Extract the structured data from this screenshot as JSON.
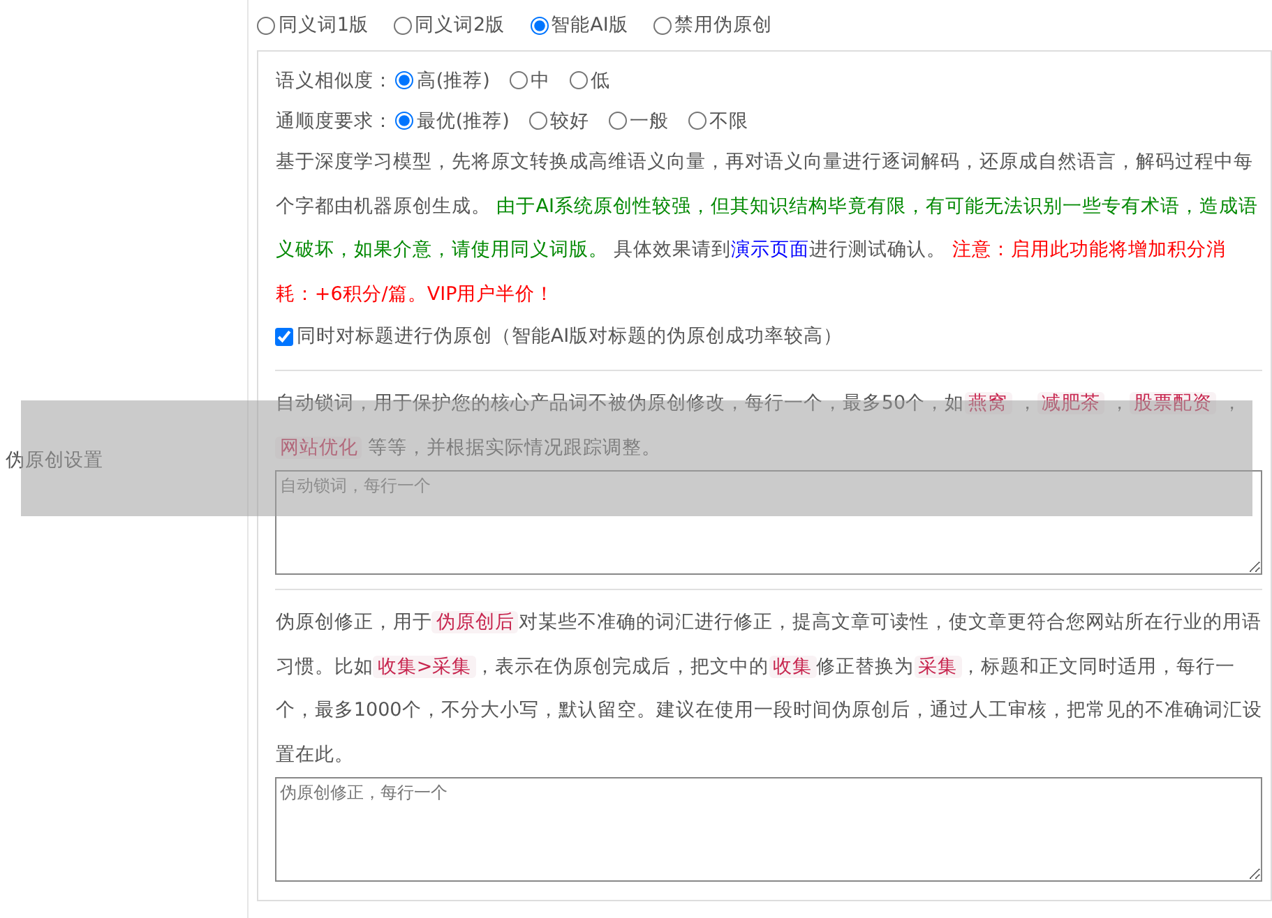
{
  "mode_options": [
    {
      "label": "同义词1版",
      "selected": false
    },
    {
      "label": "同义词2版",
      "selected": false
    },
    {
      "label": "智能AI版",
      "selected": true
    },
    {
      "label": "禁用伪原创",
      "selected": false
    }
  ],
  "settings_label": "伪原创设置",
  "similarity": {
    "label": "语义相似度：",
    "options": [
      {
        "label": "高(推荐)",
        "selected": true
      },
      {
        "label": "中",
        "selected": false
      },
      {
        "label": "低",
        "selected": false
      }
    ]
  },
  "fluency": {
    "label": "通顺度要求：",
    "options": [
      {
        "label": "最优(推荐)",
        "selected": true
      },
      {
        "label": "较好",
        "selected": false
      },
      {
        "label": "一般",
        "selected": false
      },
      {
        "label": "不限",
        "selected": false
      }
    ]
  },
  "description": [
    {
      "kind": "normal",
      "text": "基于深度学习模型，先将原文转换成高维语义向量，再对语义向量进行逐词解码，还原成自然语言，解码过程中每个字都由机器原创生成。 "
    },
    {
      "kind": "green",
      "text": "由于AI系统原创性较强，但其知识结构毕竟有限，有可能无法识别一些专有术语，造成语义破坏，如果介意，请使用同义词版。"
    },
    {
      "kind": "normal",
      "text": " 具体效果请到"
    },
    {
      "kind": "link",
      "text": "演示页面"
    },
    {
      "kind": "normal",
      "text": "进行测试确认。 "
    },
    {
      "kind": "red",
      "text": "注意：启用此功能将增加积分消耗：+6积分/篇。VIP用户半价！"
    }
  ],
  "title_checkbox": {
    "label": "同时对标题进行伪原创（智能AI版对标题的伪原创成功率较高）",
    "checked": true
  },
  "lock_words": {
    "description": [
      {
        "kind": "normal",
        "text": "自动锁词，用于保护您的核心产品词不被伪原创修改，每行一个，最多50个，如"
      },
      {
        "kind": "code",
        "text": "燕窝"
      },
      {
        "kind": "normal",
        "text": " ，"
      },
      {
        "kind": "code",
        "text": "减肥茶"
      },
      {
        "kind": "normal",
        "text": " ，"
      },
      {
        "kind": "code",
        "text": "股票配资"
      },
      {
        "kind": "normal",
        "text": " ，"
      },
      {
        "kind": "code",
        "text": "网站优化"
      },
      {
        "kind": "normal",
        "text": " 等等，并根据实际情况跟踪调整。"
      }
    ],
    "placeholder": "自动锁词，每行一个"
  },
  "correction": {
    "description": [
      {
        "kind": "normal",
        "text": "伪原创修正，用于"
      },
      {
        "kind": "code",
        "text": "伪原创后"
      },
      {
        "kind": "normal",
        "text": "对某些不准确的词汇进行修正，提高文章可读性，使文章更符合您网站所在行业的用语习惯。比如"
      },
      {
        "kind": "code",
        "text": "收集>采集"
      },
      {
        "kind": "normal",
        "text": "，表示在伪原创完成后，把文中的"
      },
      {
        "kind": "code",
        "text": "收集"
      },
      {
        "kind": "normal",
        "text": "修正替换为"
      },
      {
        "kind": "code",
        "text": "采集"
      },
      {
        "kind": "normal",
        "text": "，标题和正文同时适用，每行一个，最多1000个，不分大小写，默认留空。建议在使用一段时间伪原创后，通过人工审核，把常见的不准确词汇设置在此。"
      }
    ],
    "placeholder": "伪原创修正，每行一个"
  }
}
